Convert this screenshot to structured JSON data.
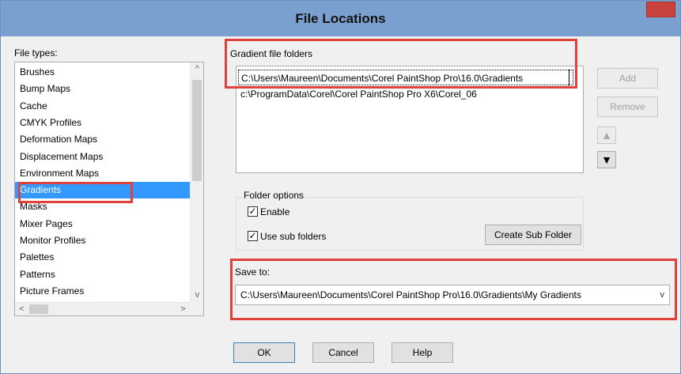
{
  "window": {
    "title": "File Locations",
    "close_glyph": "✕"
  },
  "file_types": {
    "label": "File types:",
    "items": [
      "Brushes",
      "Bump Maps",
      "Cache",
      "CMYK Profiles",
      "Deformation Maps",
      "Displacement Maps",
      "Environment Maps",
      "Gradients",
      "Masks",
      "Mixer Pages",
      "Monitor Profiles",
      "Palettes",
      "Patterns",
      "Picture Frames"
    ],
    "selected": "Gradients"
  },
  "gradient_folders": {
    "label": "Gradient file folders",
    "folders": [
      "C:\\Users\\Maureen\\Documents\\Corel PaintShop Pro\\16.0\\Gradients",
      "c:\\ProgramData\\Corel\\Corel PaintShop Pro X6\\Corel_06"
    ],
    "add_label": "Add",
    "remove_label": "Remove"
  },
  "folder_options": {
    "label": "Folder options",
    "enable_label": "Enable",
    "enable_checked": true,
    "subfolders_label": "Use sub folders",
    "subfolders_checked": true,
    "create_subfolder_label": "Create Sub Folder"
  },
  "save_to": {
    "label": "Save to:",
    "value": "C:\\Users\\Maureen\\Documents\\Corel PaintShop Pro\\16.0\\Gradients\\My Gradients"
  },
  "footer": {
    "ok_label": "OK",
    "cancel_label": "Cancel",
    "help_label": "Help"
  },
  "icons": {
    "check_glyph": "✓",
    "scroll_up": "^",
    "scroll_down": "v",
    "scroll_left": "<",
    "scroll_right": ">",
    "move_up": "▲",
    "move_down": "▼",
    "dropdown": "v"
  },
  "colors": {
    "titlebar": "#7aa0cf",
    "selection": "#3399ff",
    "highlight_annotation": "#e0413a",
    "close": "#c7423c"
  }
}
